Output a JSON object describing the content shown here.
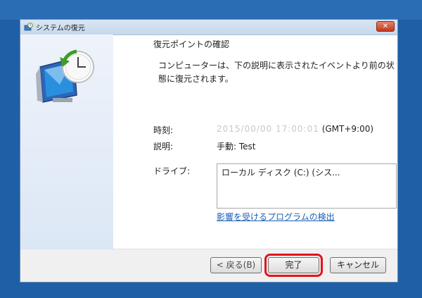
{
  "window": {
    "title": "システムの復元",
    "close_symbol": "✕"
  },
  "content": {
    "heading": "復元ポイントの確認",
    "description": "コンピューターは、下の説明に表示されたイベントより前の状態に復元されます。",
    "time_label": "時刻:",
    "time_value_obscured": "2015/00/00 17:00:01",
    "time_zone": "(GMT+9:00)",
    "description_label": "説明:",
    "description_value": "手動: Test",
    "drive_label": "ドライブ:",
    "drive_value": "ローカル ディスク (C:) (シス...",
    "affected_programs_link": "影響を受けるプログラムの検出"
  },
  "buttons": {
    "back": "< 戻る(B)",
    "finish": "完了",
    "cancel": "キャンセル"
  },
  "colors": {
    "desktop": "#1f5fa6",
    "highlight": "#e2141c",
    "link": "#1a5fb4"
  },
  "icons": {
    "title": "system-restore-icon",
    "hero": "system-restore-clock-monitor-icon",
    "close": "close-icon"
  }
}
